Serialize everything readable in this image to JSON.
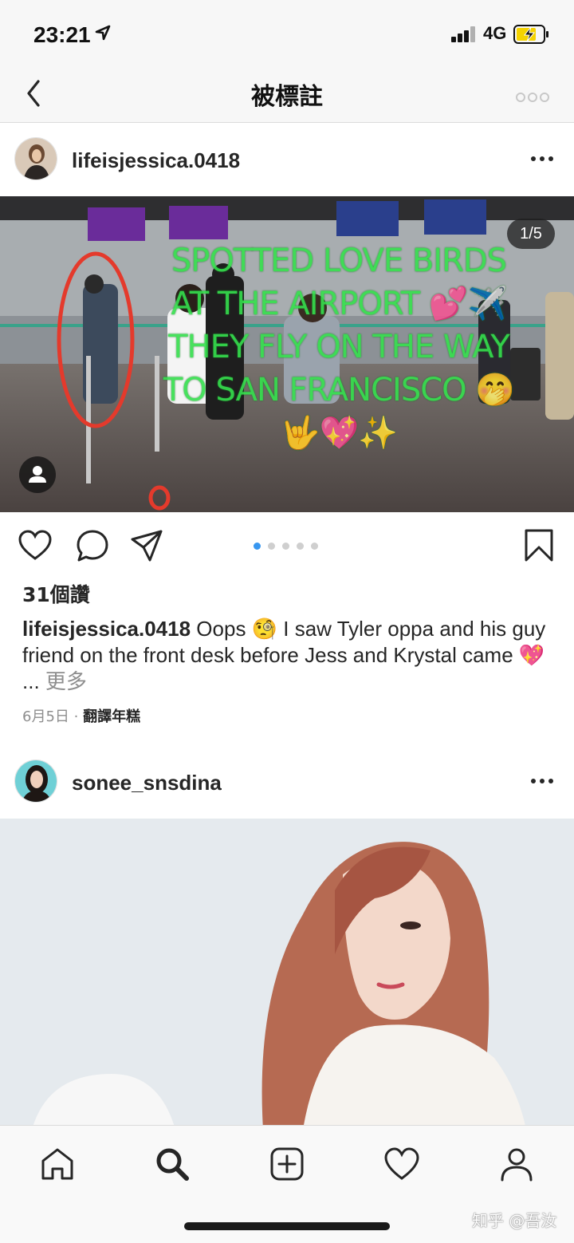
{
  "status_bar": {
    "time": "23:21",
    "network": "4G"
  },
  "nav": {
    "title": "被標註"
  },
  "posts": [
    {
      "username": "lifeisjessica.0418",
      "photo_counter": "1/5",
      "overlay_text": "SPOTTED LOVE BIRDS AT THE AIRPORT 💕✈️ THEY FLY ON THE WAY TO SAN FRANCISCO 🤭 🤟💖✨",
      "likes": "31個讚",
      "caption_user": "lifeisjessica.0418",
      "caption_text": "Oops 🧐 I saw Tyler oppa and his guy friend on the front desk before Jess and Krystal came 💖",
      "caption_ellipsis": "...",
      "caption_more": "更多",
      "date": "6月5日",
      "separator": "·",
      "translate": "翻譯年糕",
      "page_index": 1,
      "page_count": 5
    },
    {
      "username": "sonee_snsdina"
    }
  ],
  "tab_bar": {
    "items": [
      "home-icon",
      "search-icon",
      "add-post-icon",
      "activity-heart-icon",
      "profile-icon"
    ],
    "active": "search-icon"
  },
  "watermark": "知乎 @吾汝",
  "colors": {
    "overlay_text": "#35e04d",
    "pager_active": "#3897f0",
    "pager_inactive": "#cfcfcf"
  }
}
